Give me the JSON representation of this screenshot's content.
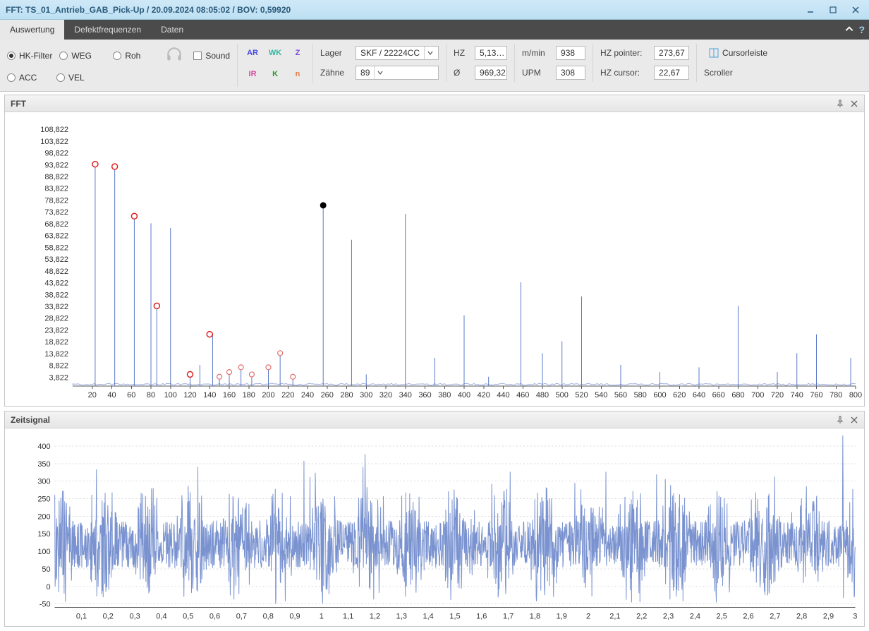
{
  "titlebar": {
    "text": "FFT:  TS_01_Antrieb_GAB_Pick-Up   /   20.09.2024 08:05:02   /   BOV: 0,59920"
  },
  "ribbon": {
    "tabs": [
      {
        "label": "Auswertung",
        "active": true
      },
      {
        "label": "Defektfrequenzen",
        "active": false
      },
      {
        "label": "Daten",
        "active": false
      }
    ]
  },
  "toolbar": {
    "radios": {
      "hk_filter": "HK-Filter",
      "acc": "ACC",
      "weg": "WEG",
      "vel": "VEL",
      "roh": "Roh"
    },
    "sound_label": "Sound",
    "channels": {
      "AR": "AR",
      "WK": "WK",
      "Z": "Z",
      "IR": "IR",
      "K": "K",
      "n": "n"
    },
    "lager_label": "Lager",
    "lager_value": "SKF / 22224CC",
    "zaehne_label": "Zähne",
    "zaehne_value": "89",
    "hz_label": "HZ",
    "hz_value": "5,13…",
    "dia_label": "Ø",
    "dia_value": "969,32",
    "mmin_label": "m/min",
    "mmin_value": "938",
    "upm_label": "UPM",
    "upm_value": "308",
    "hz_pointer_label": "HZ pointer:",
    "hz_pointer_value": "273,67",
    "hz_cursor_label": "HZ cursor:",
    "hz_cursor_value": "22,67",
    "cursorleiste": "Cursorleiste",
    "scroller": "Scroller"
  },
  "panels": {
    "fft_title": "FFT",
    "ts_title": "Zeitsignal"
  },
  "chart_data": [
    {
      "type": "bar",
      "id": "fft",
      "title": "FFT",
      "xlabel": "",
      "ylabel": "",
      "xlim": [
        0,
        800
      ],
      "ylim": [
        0,
        110
      ],
      "xticks": [
        20,
        40,
        60,
        80,
        100,
        120,
        140,
        160,
        180,
        200,
        220,
        240,
        260,
        280,
        300,
        320,
        340,
        360,
        380,
        400,
        420,
        440,
        460,
        480,
        500,
        520,
        540,
        560,
        580,
        600,
        620,
        640,
        660,
        680,
        700,
        720,
        740,
        760,
        780,
        800
      ],
      "yticks": [
        3.822,
        8.822,
        13.822,
        18.822,
        23.822,
        28.822,
        33.822,
        38.822,
        43.822,
        48.822,
        53.822,
        58.822,
        63.822,
        68.822,
        73.822,
        78.822,
        83.822,
        88.822,
        93.822,
        98.822,
        103.822,
        108.822
      ],
      "ytick_labels": [
        "3,822",
        "8,822",
        "13,822",
        "18,822",
        "23,822",
        "28,822",
        "33,822",
        "38,822",
        "43,822",
        "48,822",
        "53,822",
        "58,822",
        "63,822",
        "68,822",
        "73,822",
        "78,822",
        "83,822",
        "88,822",
        "93,822",
        "98,822",
        "103,822",
        "108,822"
      ],
      "peaks": [
        {
          "x": 23,
          "y": 94
        },
        {
          "x": 43,
          "y": 93
        },
        {
          "x": 63,
          "y": 72
        },
        {
          "x": 80,
          "y": 69
        },
        {
          "x": 86,
          "y": 34
        },
        {
          "x": 100,
          "y": 67
        },
        {
          "x": 120,
          "y": 5
        },
        {
          "x": 130,
          "y": 9
        },
        {
          "x": 143,
          "y": 22
        },
        {
          "x": 150,
          "y": 4
        },
        {
          "x": 160,
          "y": 6
        },
        {
          "x": 172,
          "y": 8
        },
        {
          "x": 183,
          "y": 5
        },
        {
          "x": 200,
          "y": 8
        },
        {
          "x": 212,
          "y": 14
        },
        {
          "x": 225,
          "y": 4
        },
        {
          "x": 256,
          "y": 76
        },
        {
          "x": 285,
          "y": 62
        },
        {
          "x": 300,
          "y": 5
        },
        {
          "x": 340,
          "y": 73
        },
        {
          "x": 370,
          "y": 12
        },
        {
          "x": 400,
          "y": 30
        },
        {
          "x": 425,
          "y": 4
        },
        {
          "x": 458,
          "y": 44
        },
        {
          "x": 480,
          "y": 14
        },
        {
          "x": 500,
          "y": 19
        },
        {
          "x": 520,
          "y": 38
        },
        {
          "x": 560,
          "y": 9
        },
        {
          "x": 600,
          "y": 6
        },
        {
          "x": 640,
          "y": 8
        },
        {
          "x": 680,
          "y": 34
        },
        {
          "x": 720,
          "y": 6
        },
        {
          "x": 740,
          "y": 14
        },
        {
          "x": 760,
          "y": 22
        },
        {
          "x": 795,
          "y": 12
        }
      ],
      "markers_red_bold": [
        23,
        43,
        63,
        86,
        120,
        140
      ],
      "markers_red_light": [
        150,
        160,
        172,
        183,
        200,
        212,
        225
      ],
      "marker_black": {
        "x": 256,
        "ypct": 0.7
      }
    },
    {
      "type": "line",
      "id": "zeitsignal",
      "title": "Zeitsignal",
      "xlabel": "",
      "ylabel": "",
      "xlim": [
        0,
        3.0
      ],
      "ylim": [
        -60,
        430
      ],
      "xticks": [
        0.1,
        0.2,
        0.3,
        0.4,
        0.5,
        0.6,
        0.7,
        0.8,
        0.9,
        1,
        1.1,
        1.2,
        1.3,
        1.4,
        1.5,
        1.6,
        1.7,
        1.8,
        1.9,
        2,
        2.1,
        2.2,
        2.3,
        2.4,
        2.5,
        2.6,
        2.7,
        2.8,
        2.9,
        3
      ],
      "xtick_labels": [
        "0,1",
        "0,2",
        "0,3",
        "0,4",
        "0,5",
        "0,6",
        "0,7",
        "0,8",
        "0,9",
        "1",
        "1,1",
        "1,2",
        "1,3",
        "1,4",
        "1,5",
        "1,6",
        "1,7",
        "1,8",
        "1,9",
        "2",
        "2,1",
        "2,2",
        "2,3",
        "2,4",
        "2,5",
        "2,6",
        "2,7",
        "2,8",
        "2,9",
        "3"
      ],
      "yticks": [
        -50,
        0,
        50,
        100,
        150,
        200,
        250,
        300,
        350,
        400
      ],
      "note": "dense noisy time-domain signal visually ranging approximately -50..420 across 0..3"
    }
  ]
}
